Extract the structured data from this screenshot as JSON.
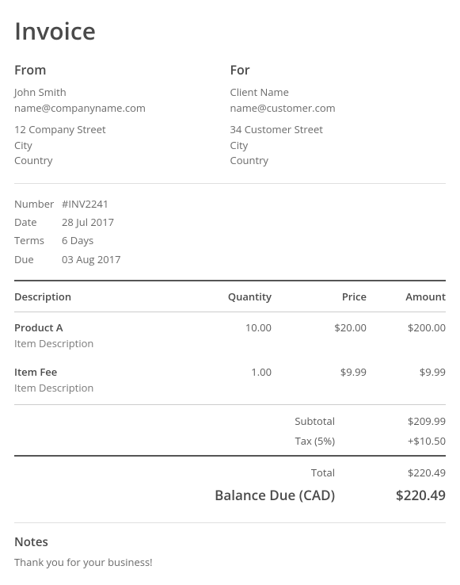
{
  "title": "Invoice",
  "from": {
    "heading": "From",
    "name": "John Smith",
    "email": "name@companyname.com",
    "street": "12 Company Street",
    "city": "City",
    "country": "Country"
  },
  "for": {
    "heading": "For",
    "name": "Client Name",
    "email": "name@customer.com",
    "street": "34 Customer Street",
    "city": "City",
    "country": "Country"
  },
  "meta": {
    "number_label": "Number",
    "number": "#INV2241",
    "date_label": "Date",
    "date": "28 Jul 2017",
    "terms_label": "Terms",
    "terms": "6 Days",
    "due_label": "Due",
    "due": "03 Aug 2017"
  },
  "columns": {
    "description": "Description",
    "quantity": "Quantity",
    "price": "Price",
    "amount": "Amount"
  },
  "items": [
    {
      "name": "Product A",
      "desc": "Item Description",
      "qty": "10.00",
      "price": "$20.00",
      "amount": "$200.00"
    },
    {
      "name": "Item Fee",
      "desc": "Item Description",
      "qty": "1.00",
      "price": "$9.99",
      "amount": "$9.99"
    }
  ],
  "totals": {
    "subtotal_label": "Subtotal",
    "subtotal": "$209.99",
    "tax_label": "Tax (5%)",
    "tax": "+$10.50",
    "total_label": "Total",
    "total": "$220.49",
    "balance_label": "Balance Due (CAD)",
    "balance": "$220.49"
  },
  "notes": {
    "heading": "Notes",
    "text": "Thank you for your business!"
  }
}
